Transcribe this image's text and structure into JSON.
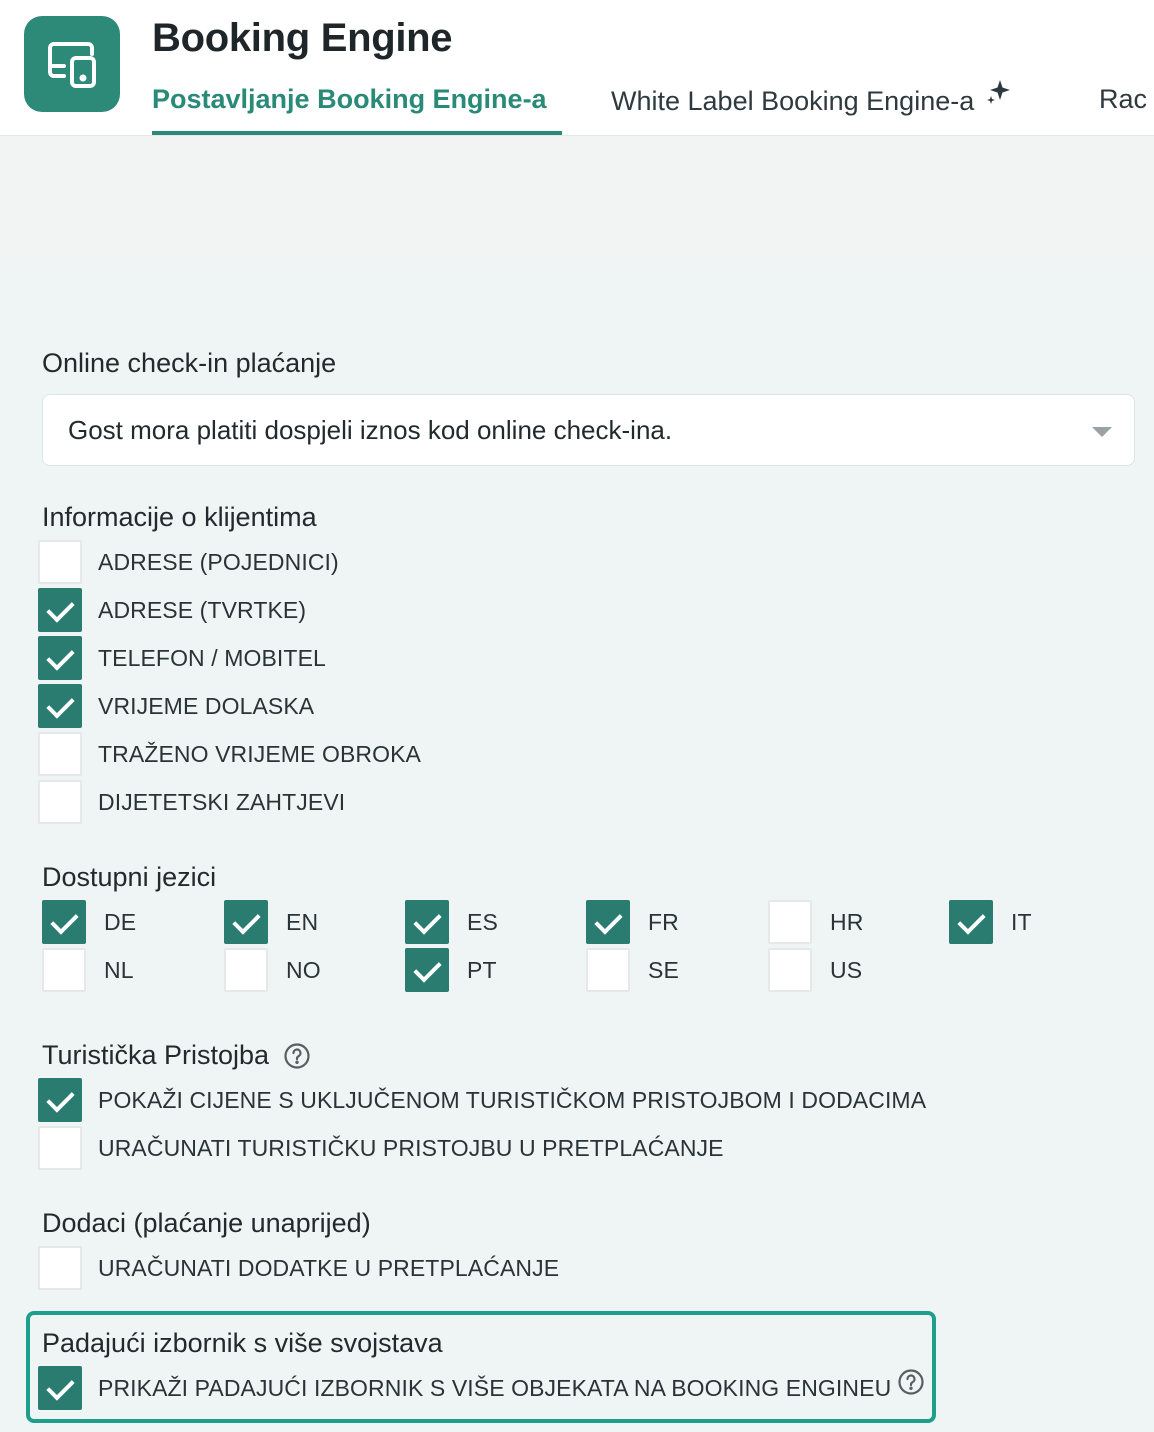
{
  "header": {
    "app_icon": "device-sync-icon",
    "title": "Booking Engine",
    "tabs": [
      {
        "label": "Postavljanje Booking Engine-a",
        "active": true
      },
      {
        "label": "White Label Booking Engine-a",
        "active": false,
        "icon": "sparkle-icon"
      },
      {
        "label": "Rac",
        "active": false
      }
    ]
  },
  "online_checkin": {
    "label": "Online check-in plaćanje",
    "selected": "Gost mora platiti dospjeli iznos kod online check-ina."
  },
  "client_info": {
    "label": "Informacije o klijentima",
    "options": [
      {
        "label": "ADRESE (POJEDNICI)",
        "checked": false
      },
      {
        "label": "ADRESE (TVRTKE)",
        "checked": true
      },
      {
        "label": "TELEFON / MOBITEL",
        "checked": true
      },
      {
        "label": "VRIJEME DOLASKA",
        "checked": true
      },
      {
        "label": "TRAŽENO VRIJEME OBROKA",
        "checked": false
      },
      {
        "label": "DIJETETSKI ZAHTJEVI",
        "checked": false
      }
    ]
  },
  "languages": {
    "label": "Dostupni jezici",
    "items": [
      {
        "code": "DE",
        "checked": true
      },
      {
        "code": "EN",
        "checked": true
      },
      {
        "code": "ES",
        "checked": true
      },
      {
        "code": "FR",
        "checked": true
      },
      {
        "code": "HR",
        "checked": false
      },
      {
        "code": "IT",
        "checked": true
      },
      {
        "code": "NL",
        "checked": false
      },
      {
        "code": "NO",
        "checked": false
      },
      {
        "code": "PT",
        "checked": true
      },
      {
        "code": "SE",
        "checked": false
      },
      {
        "code": "US",
        "checked": false
      }
    ]
  },
  "tourist_tax": {
    "label": "Turistička Pristojba",
    "options": [
      {
        "label": "POKAŽI CIJENE S UKLJUČENOM TURISTIČKOM PRISTOJBOM I DODACIMA",
        "checked": true
      },
      {
        "label": "URAČUNATI TURISTIČKU PRISTOJBU U PRETPLAĆANJE",
        "checked": false
      }
    ]
  },
  "extras": {
    "label": "Dodaci (plaćanje unaprijed)",
    "options": [
      {
        "label": "URAČUNATI DODATKE U PRETPLAĆANJE",
        "checked": false
      }
    ]
  },
  "multi_property": {
    "label": "Padajući izbornik s više svojstava",
    "options": [
      {
        "label": "PRIKAŽI PADAJUĆI IZBORNIK S VIŠE OBJEKATA NA BOOKING ENGINEU",
        "checked": true
      }
    ]
  },
  "colors": {
    "accent": "#2a8a78",
    "checkbox_checked": "#2a7c70",
    "highlight_border": "#1e9f8c"
  }
}
